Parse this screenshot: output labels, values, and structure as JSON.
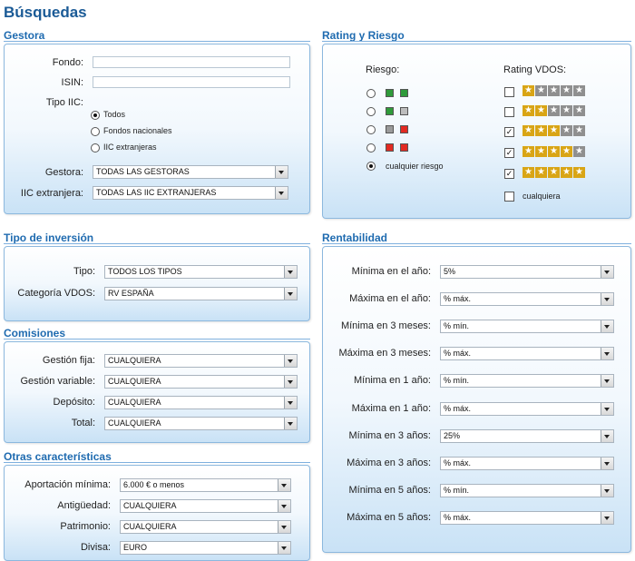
{
  "page": {
    "title": "Búsquedas"
  },
  "gestora": {
    "heading": "Gestora",
    "fondo_label": "Fondo:",
    "fondo_value": "",
    "isin_label": "ISIN:",
    "isin_value": "",
    "tipo_label": "Tipo IIC:",
    "tipo_options": [
      "Todos",
      "Fondos nacionales",
      "IIC extranjeras"
    ],
    "tipo_selected": 0,
    "gestora_label": "Gestora:",
    "gestora_value": "TODAS LAS GESTORAS",
    "iic_label": "IIC extranjera:",
    "iic_value": "TODAS LAS IIC EXTRANJERAS"
  },
  "rating": {
    "heading": "Rating y Riesgo",
    "riesgo_label": "Riesgo:",
    "rating_label": "Rating VDOS:",
    "risk_levels": [
      {
        "color": "#2f9a3a"
      },
      {
        "color": "#2f9a3a",
        "color2": "#bdbdbd"
      },
      {
        "color": "#9a9a9a",
        "color2": "#e22a22"
      },
      {
        "color": "#e22a22"
      }
    ],
    "risk_any_label": "cualquier riesgo",
    "risk_selected": 4,
    "ratings": [
      {
        "stars": 1,
        "checked": false
      },
      {
        "stars": 2,
        "checked": false
      },
      {
        "stars": 3,
        "checked": true
      },
      {
        "stars": 4,
        "checked": true
      },
      {
        "stars": 5,
        "checked": true
      }
    ],
    "rating_any_label": "cualquiera",
    "rating_any_checked": false,
    "star_color": "#d9a515",
    "star_off_color": "#8f8f8f"
  },
  "tipo_inversion": {
    "heading": "Tipo de inversión",
    "tipo_label": "Tipo:",
    "tipo_value": "TODOS LOS TIPOS",
    "categoria_label": "Categoría VDOS:",
    "categoria_value": "RV ESPAÑA"
  },
  "comisiones": {
    "heading": "Comisiones",
    "rows": [
      {
        "label": "Gestión fija:",
        "value": "CUALQUIERA"
      },
      {
        "label": "Gestión variable:",
        "value": "CUALQUIERA"
      },
      {
        "label": "Depósito:",
        "value": "CUALQUIERA"
      },
      {
        "label": "Total:",
        "value": "CUALQUIERA"
      }
    ]
  },
  "otras": {
    "heading": "Otras características",
    "rows": [
      {
        "label": "Aportación mínima:",
        "value": "6.000 € o menos"
      },
      {
        "label": "Antigüedad:",
        "value": "CUALQUIERA"
      },
      {
        "label": "Patrimonio:",
        "value": "CUALQUIERA"
      },
      {
        "label": "Divisa:",
        "value": "EURO"
      }
    ]
  },
  "rentabilidad": {
    "heading": "Rentabilidad",
    "rows": [
      {
        "label": "Mínima en el año:",
        "value": "5%"
      },
      {
        "label": "Máxima en el año:",
        "value": "% máx."
      },
      {
        "label": "Mínima en 3 meses:",
        "value": "% mín."
      },
      {
        "label": "Máxima en 3 meses:",
        "value": "% máx."
      },
      {
        "label": "Mínima en 1 año:",
        "value": "% mín."
      },
      {
        "label": "Máxima en 1 año:",
        "value": "% máx."
      },
      {
        "label": "Mínima en 3 años:",
        "value": "25%"
      },
      {
        "label": "Máxima en 3 años:",
        "value": "% máx."
      },
      {
        "label": "Mínima en 5 años:",
        "value": "% mín."
      },
      {
        "label": "Máxima en 5 años:",
        "value": "% máx."
      }
    ]
  }
}
